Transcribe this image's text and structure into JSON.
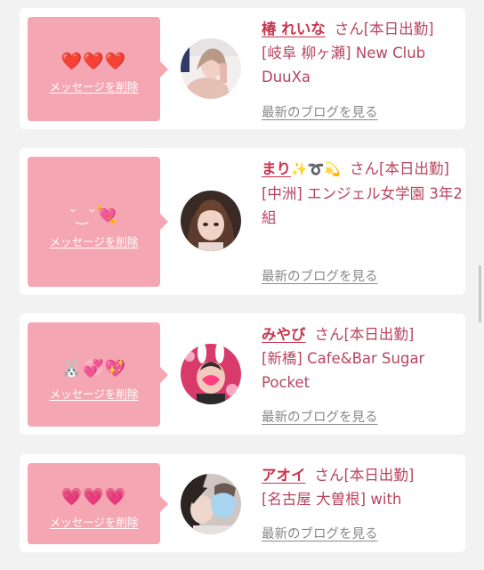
{
  "cards": [
    {
      "bubble_emoji": "❤️❤️❤️",
      "delete_label": "メッセージを削除",
      "name": "椿 れいな",
      "name_icons": "",
      "suffix": "さん[本日出勤]",
      "shop": "[岐阜 柳ヶ瀬] New Club DuuXa",
      "blog_label": "最新のブログを見る"
    },
    {
      "bubble_emoji": "˘ ͜ ˘ 💘",
      "bubble_kaomoji": "˘ ͜ ˘",
      "bubble_heart": "💘",
      "delete_label": "メッセージを削除",
      "name": "まり",
      "name_icons": "✨➰💫",
      "suffix": "さん[本日出勤]",
      "shop": "[中洲] エンジェル女学園 3年2組",
      "blog_label": "最新のブログを見る"
    },
    {
      "bubble_emoji": "🐰💞💖",
      "bubble_rabbit": "🐰",
      "bubble_hearts": "💞💖",
      "delete_label": "メッセージを削除",
      "name": "みやび",
      "name_icons": "",
      "suffix": "さん[本日出勤]",
      "shop": "[新橋] Cafe&Bar Sugar Pocket",
      "blog_label": "最新のブログを見る"
    },
    {
      "bubble_emoji": "💗💗💗",
      "delete_label": "メッセージを削除",
      "name": "アオイ",
      "name_icons": "",
      "suffix": "さん[本日出勤]",
      "shop": "[名古屋 大曽根] with",
      "blog_label": "最新のブログを見る"
    }
  ],
  "colors": {
    "bubble": "#f4a6b2",
    "name": "#c8364e",
    "text": "#b84560",
    "link_gray": "#888888"
  }
}
